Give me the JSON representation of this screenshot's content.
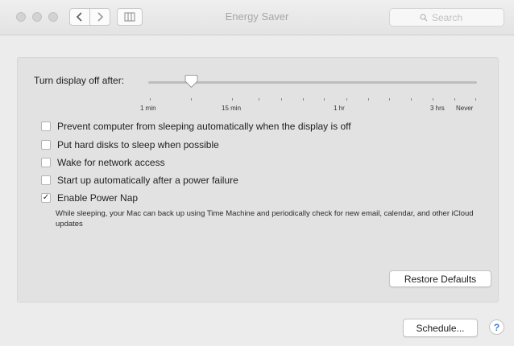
{
  "window": {
    "title": "Energy Saver"
  },
  "search": {
    "placeholder": "Search",
    "icon": "magnifier"
  },
  "slider": {
    "label": "Turn display off after:",
    "value_minutes": 5,
    "ticks": [
      "1 min",
      "15 min",
      "1 hr",
      "3 hrs",
      "Never"
    ]
  },
  "options": [
    {
      "label": "Prevent computer from sleeping automatically when the display is off",
      "checked": false
    },
    {
      "label": "Put hard disks to sleep when possible",
      "checked": false
    },
    {
      "label": "Wake for network access",
      "checked": false
    },
    {
      "label": "Start up automatically after a power failure",
      "checked": false
    },
    {
      "label": "Enable Power Nap",
      "checked": true
    }
  ],
  "power_nap_description": "While sleeping, your Mac can back up using Time Machine and periodically check for new email, calendar, and other iCloud updates",
  "buttons": {
    "restore_defaults": "Restore Defaults",
    "schedule": "Schedule...",
    "help": "?"
  },
  "icons": {
    "back": "chevron-left",
    "forward": "chevron-right",
    "show_all": "grid",
    "checkmark": "✓",
    "accent_color": "#3e7de3"
  }
}
